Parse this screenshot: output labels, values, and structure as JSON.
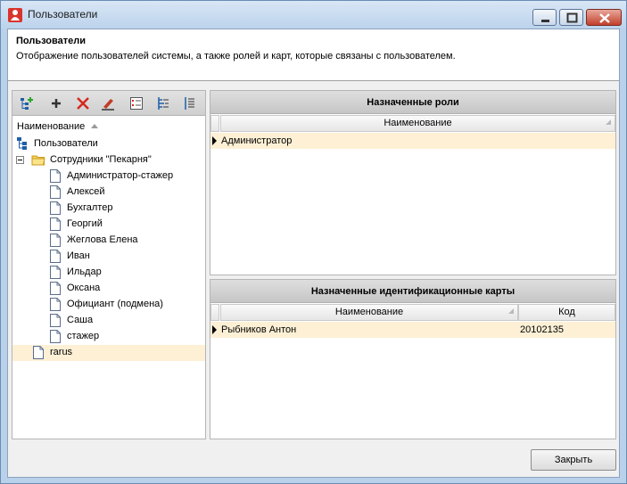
{
  "window": {
    "title": "Пользователи",
    "controls": {
      "minimize": "minimize",
      "maximize": "maximize",
      "close": "close"
    }
  },
  "header": {
    "title": "Пользователи",
    "description": "Отображение пользователей системы, а также ролей и карт, которые связаны с пользователем."
  },
  "toolbar": {
    "buttons": [
      {
        "name": "add-group",
        "icon": "tree-add-icon"
      },
      {
        "name": "add",
        "icon": "plus-icon"
      },
      {
        "name": "delete",
        "icon": "red-x-icon"
      },
      {
        "name": "edit",
        "icon": "pencil-icon"
      },
      {
        "name": "properties",
        "icon": "list-properties-icon"
      },
      {
        "name": "expand-all",
        "icon": "tree-expand-icon"
      },
      {
        "name": "collapse-all",
        "icon": "tree-collapse-icon"
      }
    ]
  },
  "tree": {
    "column_header": "Наименование",
    "root": "Пользователи",
    "group": "Сотрудники \"Пекарня\"",
    "users": [
      "Администратор-стажер",
      "Алексей",
      "Бухгалтер",
      "Георгий",
      "Жеглова Елена",
      "Иван",
      "Ильдар",
      "Оксана",
      "Официант (подмена)",
      "Саша",
      "стажер"
    ],
    "extra_user": "rarus"
  },
  "roles": {
    "title": "Назначенные роли",
    "column_name": "Наименование",
    "rows": [
      {
        "name": "Администратор"
      }
    ]
  },
  "cards": {
    "title": "Назначенные идентификационные карты",
    "column_name": "Наименование",
    "column_code": "Код",
    "rows": [
      {
        "name": "Рыбников Антон",
        "code": "20102135"
      }
    ]
  },
  "footer": {
    "close_label": "Закрыть"
  },
  "colors": {
    "selection": "#fdf0d5",
    "title_bar": "#bcd3ec",
    "close_button": "#c2402c"
  }
}
